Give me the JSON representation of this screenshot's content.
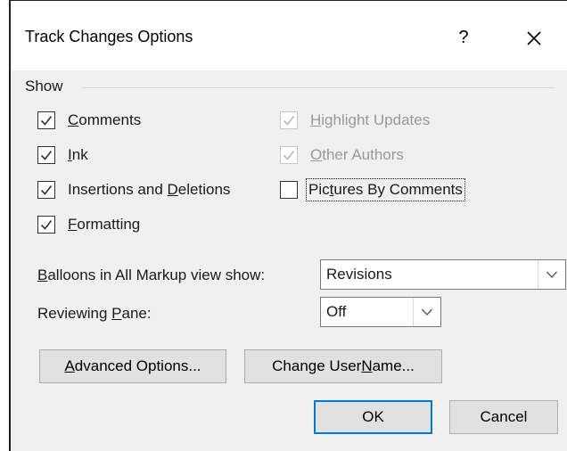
{
  "dialog": {
    "title": "Track Changes Options",
    "help_glyph": "?",
    "close_glyph": "✕"
  },
  "show_group": {
    "label": "Show",
    "checkboxes": [
      {
        "label_pre": "",
        "label_u": "C",
        "label_post": "omments",
        "checked": true,
        "enabled": true
      },
      {
        "label_pre": "",
        "label_u": "I",
        "label_post": "nk",
        "checked": true,
        "enabled": true
      },
      {
        "label_pre": "Insertions and ",
        "label_u": "D",
        "label_post": "eletions",
        "checked": true,
        "enabled": true
      },
      {
        "label_pre": "",
        "label_u": "F",
        "label_post": "ormatting",
        "checked": true,
        "enabled": true
      },
      {
        "label_pre": "",
        "label_u": "H",
        "label_post": "ighlight Updates",
        "checked": true,
        "enabled": false
      },
      {
        "label_pre": "",
        "label_u": "O",
        "label_post": "ther Authors",
        "checked": true,
        "enabled": false
      },
      {
        "label_pre": "Pic",
        "label_u": "t",
        "label_post": "ures By Comments",
        "checked": false,
        "enabled": true,
        "focused": true
      }
    ]
  },
  "balloons": {
    "label_u": "B",
    "label_post": "alloons in All Markup view show:",
    "value": "Revisions"
  },
  "reviewing_pane": {
    "label_pre": "Reviewing ",
    "label_u": "P",
    "label_post": "ane:",
    "value": "Off"
  },
  "buttons": {
    "advanced": {
      "pre": "",
      "u": "A",
      "post": "dvanced Options..."
    },
    "change_user": {
      "pre": "Change User ",
      "u": "N",
      "post": "ame..."
    },
    "ok": "OK",
    "cancel": "Cancel"
  }
}
